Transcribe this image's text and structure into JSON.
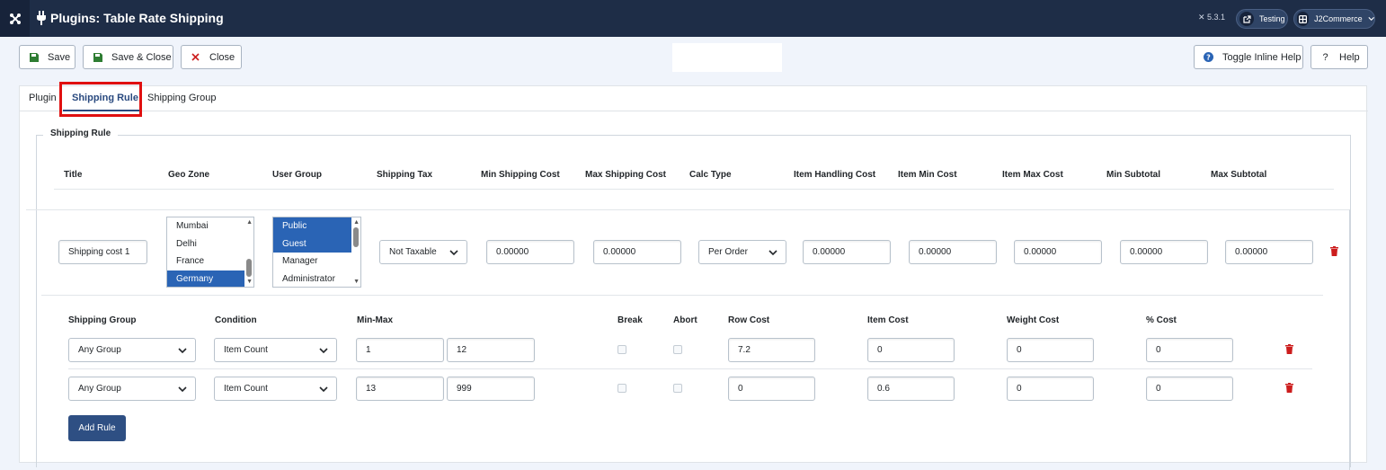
{
  "header": {
    "title": "Plugins: Table Rate Shipping",
    "version": "5.3.1",
    "site_pill": "Testing",
    "user_pill": "J2Commerce"
  },
  "toolbar": {
    "save": "Save",
    "save_close": "Save & Close",
    "close": "Close",
    "toggle_help": "Toggle Inline Help",
    "help": "Help"
  },
  "tabs": [
    {
      "label": "Plugin"
    },
    {
      "label": "Shipping Rule",
      "active": true
    },
    {
      "label": "Shipping Group"
    }
  ],
  "fieldset_legend": "Shipping Rule",
  "columns": [
    "Title",
    "Geo Zone",
    "User Group",
    "Shipping Tax",
    "Min Shipping Cost",
    "Max Shipping Cost",
    "Calc Type",
    "Item Handling Cost",
    "Item Min Cost",
    "Item Max Cost",
    "Min Subtotal",
    "Max Subtotal"
  ],
  "rule": {
    "title": "Shipping cost 1",
    "geo_zones": [
      {
        "label": "Mumbai",
        "selected": false
      },
      {
        "label": "Delhi",
        "selected": false
      },
      {
        "label": "France",
        "selected": false
      },
      {
        "label": "Germany",
        "selected": true
      }
    ],
    "user_groups": [
      {
        "label": "Public",
        "selected": true
      },
      {
        "label": "Guest",
        "selected": true
      },
      {
        "label": "Manager",
        "selected": false
      },
      {
        "label": "Administrator",
        "selected": false
      }
    ],
    "shipping_tax": "Not Taxable",
    "min_shipping_cost": "0.00000",
    "max_shipping_cost": "0.00000",
    "calc_type": "Per Order",
    "item_handling_cost": "0.00000",
    "item_min_cost": "0.00000",
    "item_max_cost": "0.00000",
    "min_subtotal": "0.00000",
    "max_subtotal": "0.00000"
  },
  "sub_columns": [
    "Shipping Group",
    "Condition",
    "Min-Max",
    "Break",
    "Abort",
    "Row Cost",
    "Item Cost",
    "Weight Cost",
    "% Cost"
  ],
  "sub_rules": [
    {
      "group": "Any Group",
      "condition": "Item Count",
      "min": "1",
      "max": "12",
      "row_cost": "7.2",
      "item_cost": "0",
      "weight_cost": "0",
      "pct_cost": "0"
    },
    {
      "group": "Any Group",
      "condition": "Item Count",
      "min": "13",
      "max": "999",
      "row_cost": "0",
      "item_cost": "0.6",
      "weight_cost": "0",
      "pct_cost": "0"
    }
  ],
  "add_rule": "Add Rule",
  "colors": {
    "topbar": "#1e2d47",
    "accent": "#2a4a7f",
    "selected": "#2a64b5",
    "danger": "#cc1d1d",
    "highlight": "#e01010"
  }
}
